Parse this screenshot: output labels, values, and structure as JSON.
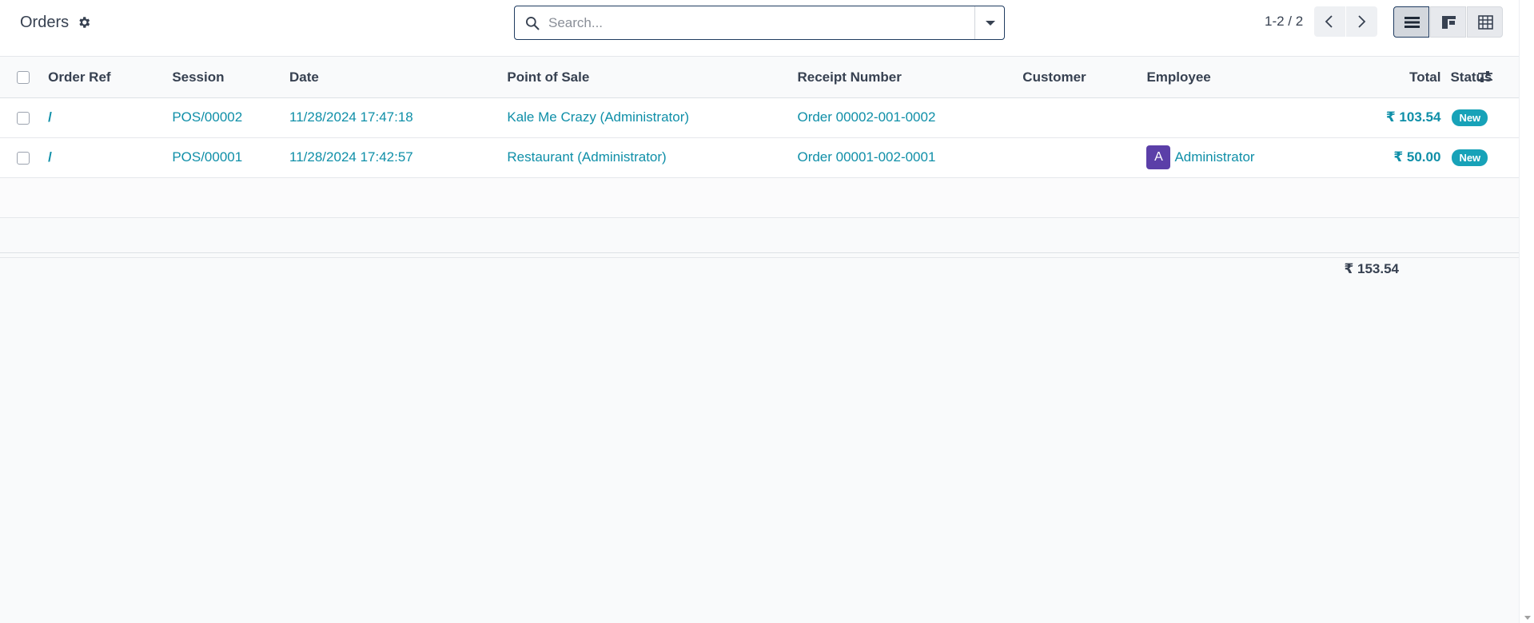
{
  "header": {
    "title": "Orders",
    "search_placeholder": "Search...",
    "pager": "1-2 / 2"
  },
  "table": {
    "columns": [
      "Order Ref",
      "Session",
      "Date",
      "Point of Sale",
      "Receipt Number",
      "Customer",
      "Employee",
      "Total",
      "Status"
    ],
    "rows": [
      {
        "order_ref": "/",
        "session": "POS/00002",
        "date": "11/28/2024 17:47:18",
        "point_of_sale": "Kale Me Crazy (Administrator)",
        "receipt_number": "Order 00002-001-0002",
        "customer": "",
        "employee": "",
        "employee_initial": "",
        "total": "₹ 103.54",
        "status": "New"
      },
      {
        "order_ref": "/",
        "session": "POS/00001",
        "date": "11/28/2024 17:42:57",
        "point_of_sale": "Restaurant (Administrator)",
        "receipt_number": "Order 00001-002-0001",
        "customer": "",
        "employee": "Administrator",
        "employee_initial": "A",
        "total": "₹ 50.00",
        "status": "New"
      }
    ],
    "footer_total": "₹ 153.54"
  },
  "icons": {
    "settings": "gear-icon",
    "search": "search-icon",
    "prev": "chevron-left-icon",
    "next": "chevron-right-icon",
    "list_view": "list-view-icon",
    "kanban_view": "kanban-view-icon",
    "pivot_view": "pivot-view-icon",
    "optional_columns": "sliders-icon"
  },
  "colors": {
    "link": "#0f8fa8",
    "badge": "#17a2b8",
    "avatar": "#5b3fa8",
    "search_border": "#1f3b60"
  }
}
